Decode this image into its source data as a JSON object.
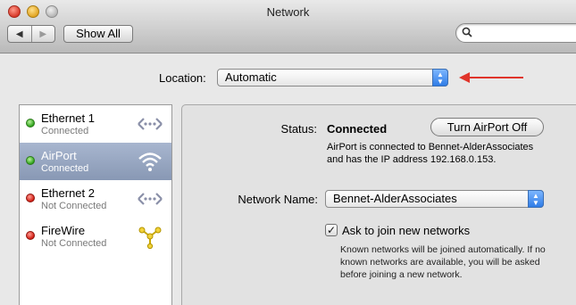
{
  "window": {
    "title": "Network"
  },
  "toolbar": {
    "back_glyph": "◀",
    "forward_glyph": "▶",
    "show_all_label": "Show All",
    "search_placeholder": "",
    "search_icon": "search-icon"
  },
  "location": {
    "label": "Location:",
    "value": "Automatic",
    "annotation_arrow_color": "#e0342a"
  },
  "services": [
    {
      "name": "Ethernet 1",
      "status": "Connected",
      "indicator": "green",
      "icon": "ethernet-icon",
      "selected": false
    },
    {
      "name": "AirPort",
      "status": "Connected",
      "indicator": "green",
      "icon": "wifi-icon",
      "selected": true
    },
    {
      "name": "Ethernet 2",
      "status": "Not Connected",
      "indicator": "red",
      "icon": "ethernet-icon",
      "selected": false
    },
    {
      "name": "FireWire",
      "status": "Not Connected",
      "indicator": "red",
      "icon": "firewire-icon",
      "selected": false
    }
  ],
  "detail": {
    "status_label": "Status:",
    "status_value": "Connected",
    "airport_button": "Turn AirPort Off",
    "status_description": "AirPort is connected to Bennet-AlderAssociates and has the IP address 192.168.0.153.",
    "network_name_label": "Network Name:",
    "network_name_value": "Bennet-AlderAssociates",
    "ask_checkbox_label": "Ask to join new networks",
    "ask_checkbox_checked": true,
    "ask_description": "Known networks will be joined automatically. If no known networks are available, you will be asked before joining a new network."
  },
  "colors": {
    "selection": "#8e9db8",
    "status_green": "#2fa21c",
    "status_red": "#d21d13",
    "popup_accent": "#2f7ce6"
  }
}
